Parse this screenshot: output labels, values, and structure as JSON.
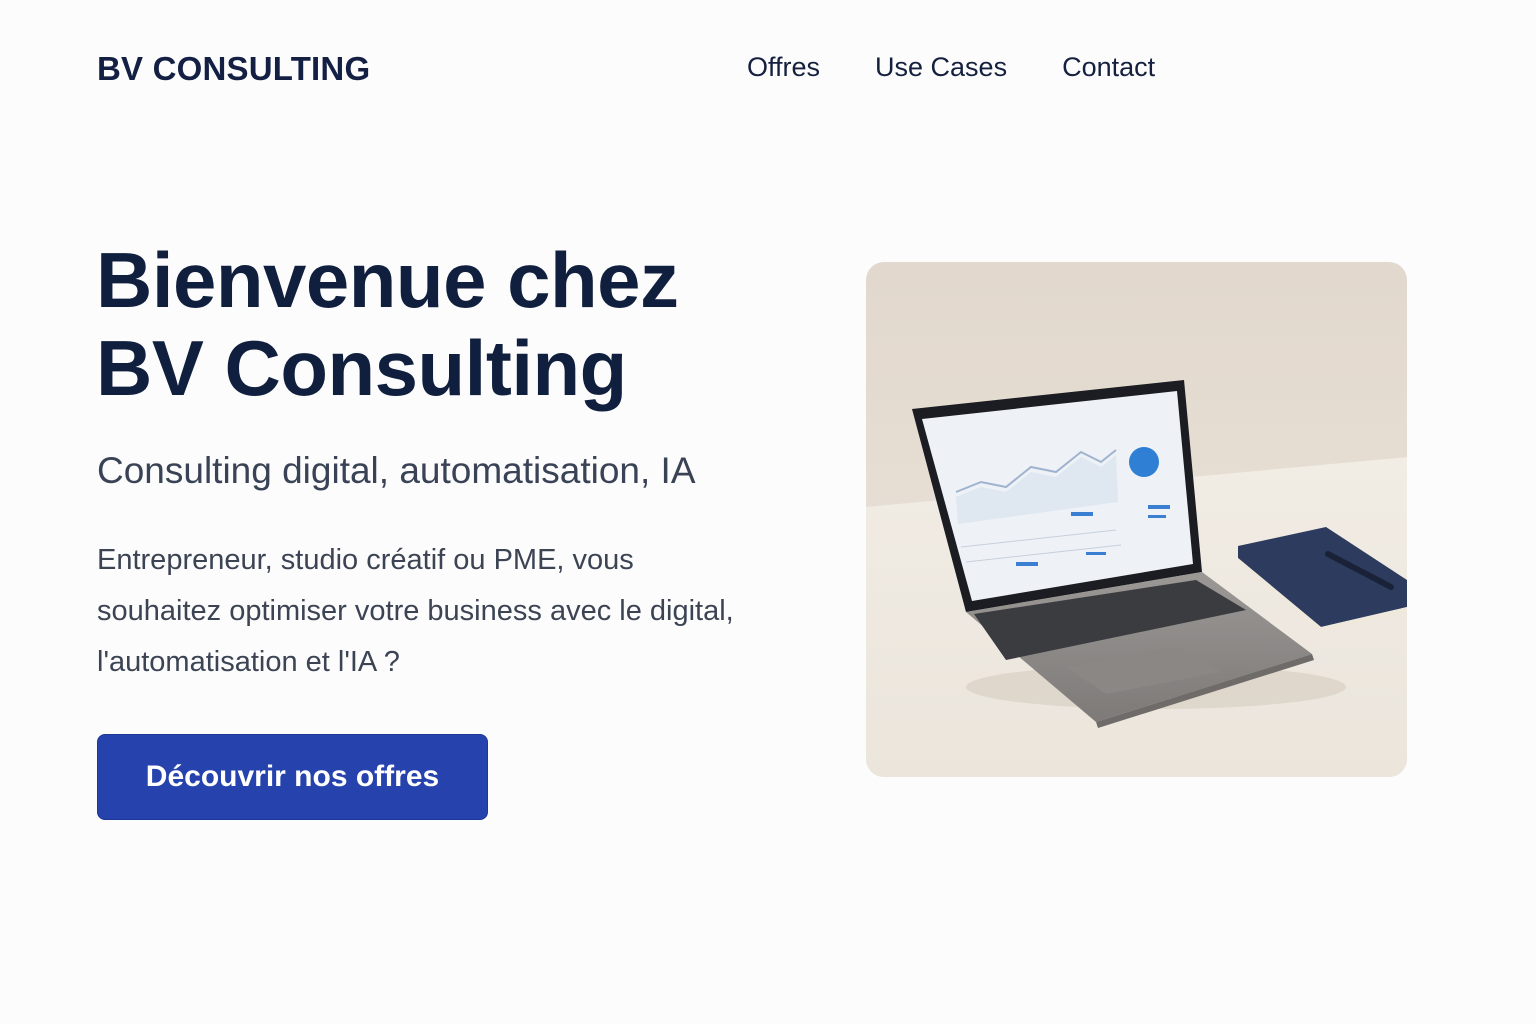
{
  "header": {
    "logo": "BV CONSULTING",
    "nav": [
      "Offres",
      "Use Cases",
      "Contact"
    ]
  },
  "hero": {
    "title_line1": "Bienvenue chez",
    "title_line2": "BV Consulting",
    "subtitle": "Consulting digital, automatisation, IA",
    "description": "Entrepreneur, studio créatif ou PME, vous souhaitez optimiser votre business avec le digital, l'automatisation et l'IA ?",
    "cta_label": "Découvrir nos offres",
    "image_icon": "laptop-dashboard-photo"
  },
  "colors": {
    "accent": "#2642ad",
    "heading": "#0f1f3d",
    "body_text": "#3c4454",
    "background": "#fcfcfd"
  }
}
